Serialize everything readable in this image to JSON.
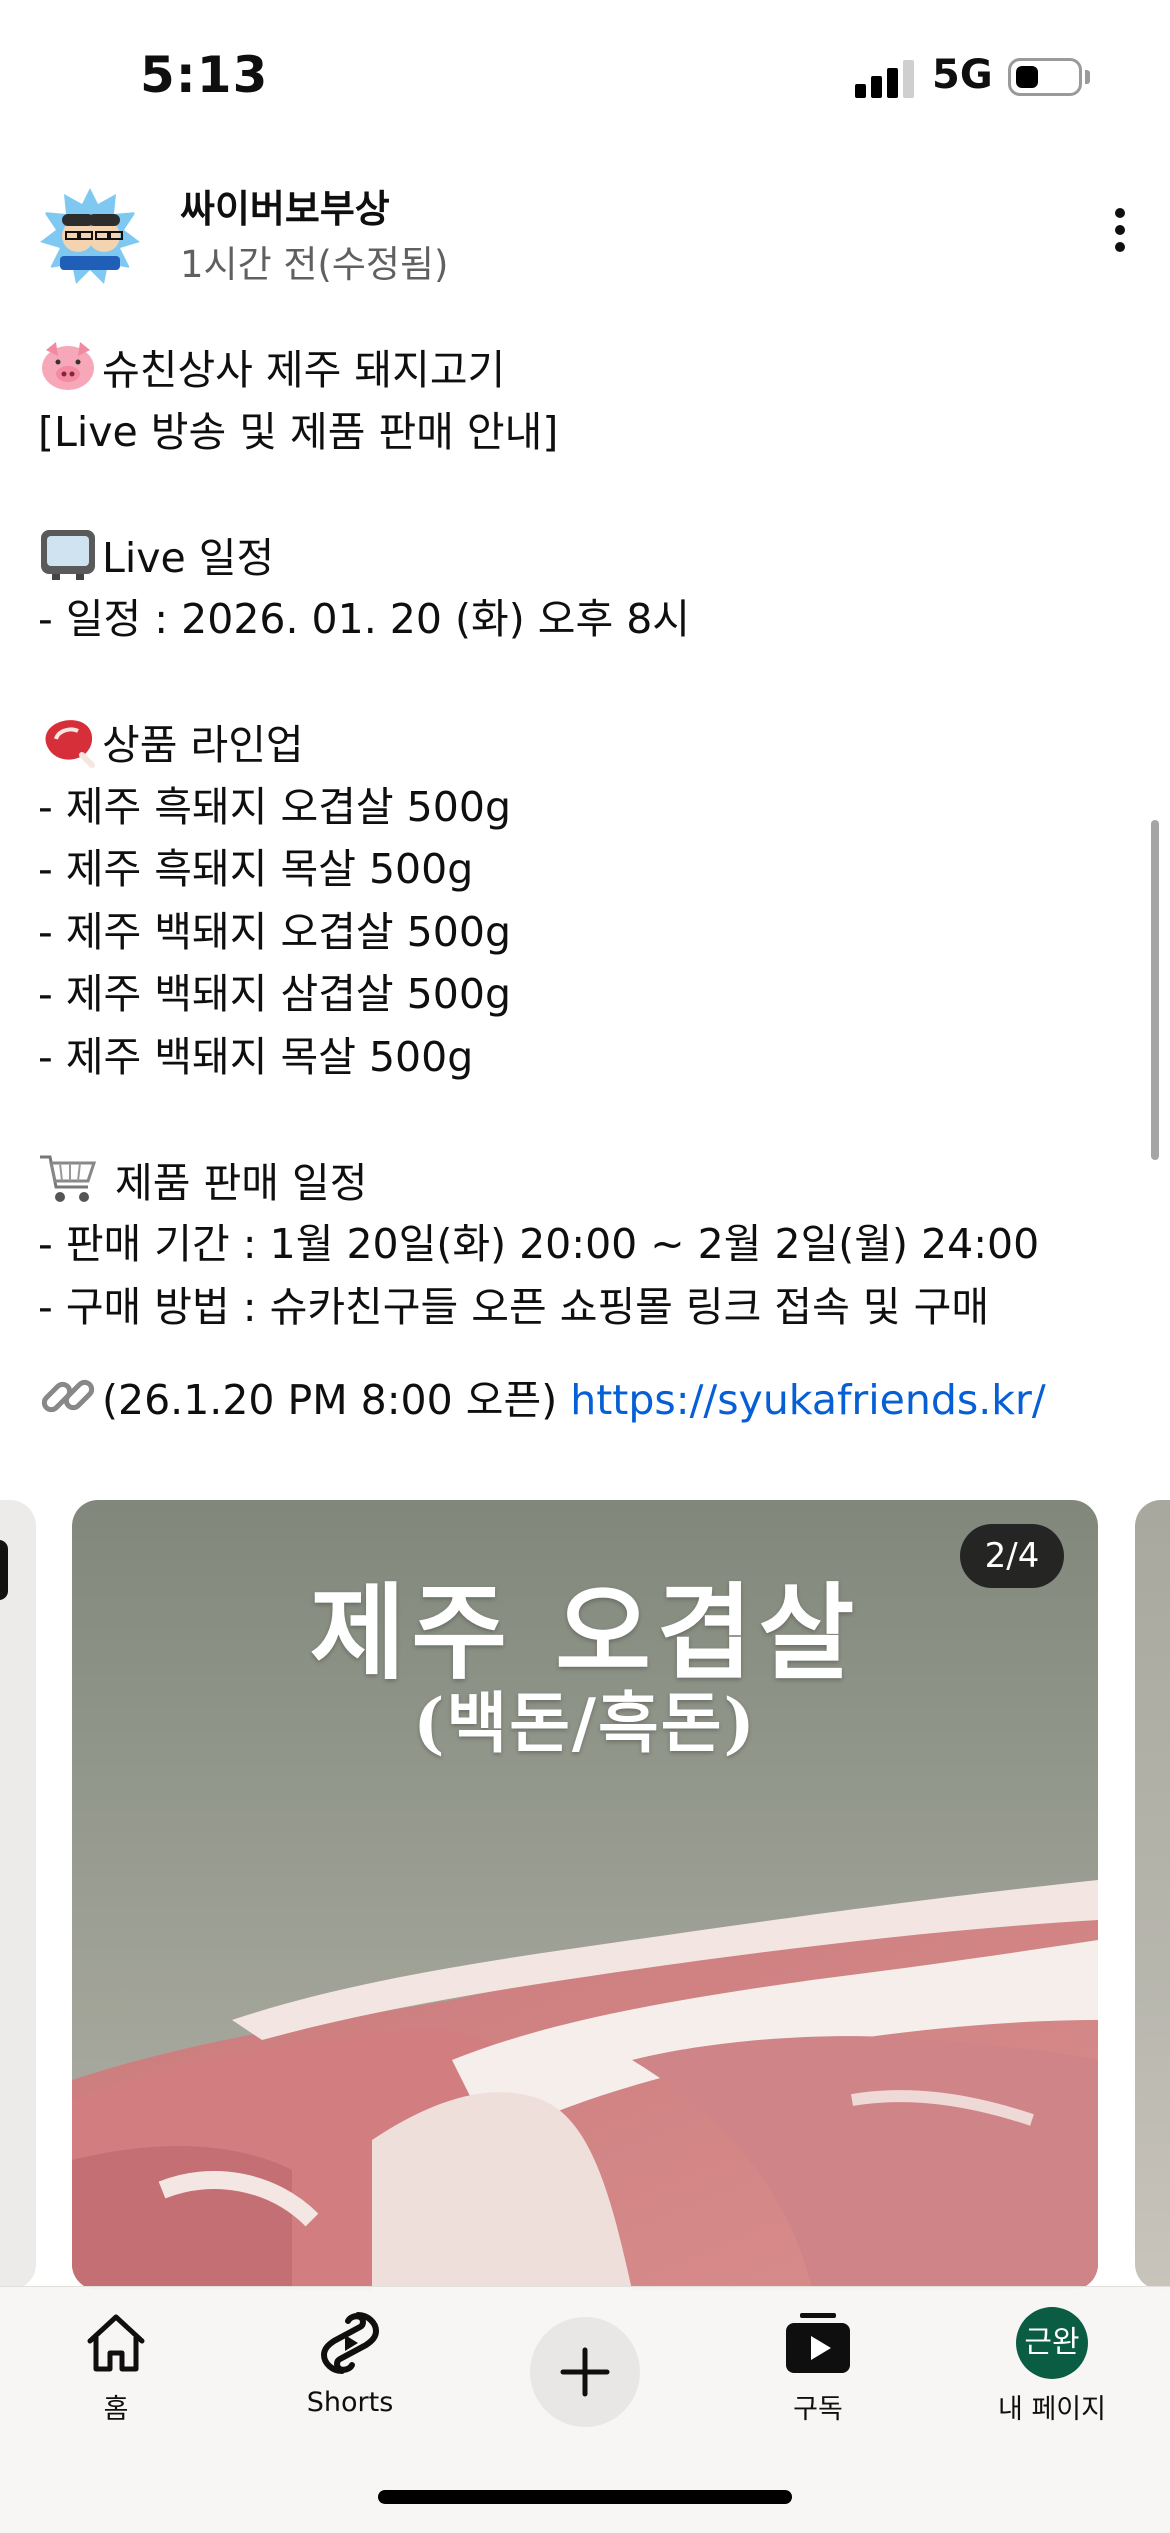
{
  "status_bar": {
    "time": "5:13",
    "network": "5G",
    "signal_icon": "signal-bars-icon",
    "battery_icon": "battery-icon"
  },
  "post": {
    "channel_name": "싸이버보부상",
    "timestamp": "1시간 전(수정됨)",
    "avatar_icon": "channel-avatar",
    "more_icon": "more-vertical-icon",
    "lines": {
      "l1": "슈친상사 제주 돼지고기",
      "l2": "[Live 방송 및 제품 판매 안내]",
      "l3": "Live 일정",
      "l4": "- 일정 : 2026. 01. 20 (화) 오후 8시",
      "l5": "상품 라인업",
      "l6": "- 제주 흑돼지 오겹살 500g",
      "l7": "- 제주 흑돼지 목살 500g",
      "l8": "- 제주 백돼지 오겹살 500g",
      "l9": "- 제주 백돼지 삼겹살 500g",
      "l10": "- 제주 백돼지 목살 500g",
      "l11": " 제품 판매 일정",
      "l12": "- 판매 기간 : 1월 20일(화) 20:00 ~ 2월 2일(월) 24:00",
      "l13": "- 구매 방법 : 슈카친구들 오픈 쇼핑몰 링크 접속 및 구매",
      "l14": "(26.1.20 PM 8:00 오픈) ",
      "link": "https://syukafriends.kr/"
    },
    "emoji_icons": [
      "pig-face-icon",
      "television-icon",
      "cut-of-meat-icon",
      "shopping-cart-icon",
      "link-icon"
    ]
  },
  "carousel": {
    "page_counter": "2/4",
    "image_title": "제주 오겹살",
    "image_subtitle": "(백돈/흑돈)",
    "image_icon": "pork-belly-photo"
  },
  "bottom_nav": {
    "home": "홈",
    "shorts": "Shorts",
    "subscriptions": "구독",
    "profile": "내 페이지",
    "profile_initials": "근완",
    "create_icon": "plus-icon"
  }
}
